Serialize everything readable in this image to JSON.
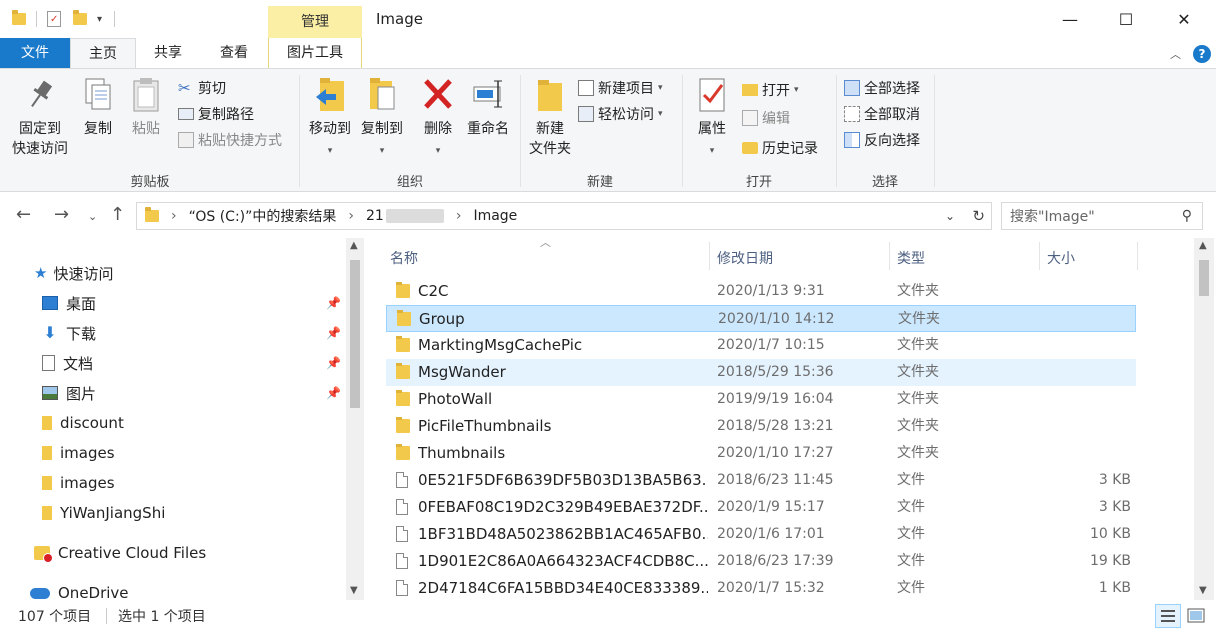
{
  "window": {
    "title": "Image",
    "context_tab": "管理",
    "minimize_glyph": "—",
    "maximize_glyph": "☐",
    "close_glyph": "✕"
  },
  "tabs": {
    "file": "文件",
    "home": "主页",
    "share": "共享",
    "view": "查看",
    "picture_tools": "图片工具",
    "help_glyph": "?"
  },
  "ribbon": {
    "clipboard": {
      "pin": "固定到",
      "pin2": "快速访问",
      "copy": "复制",
      "paste": "粘贴",
      "cut": "剪切",
      "copy_path": "复制路径",
      "paste_shortcut": "粘贴快捷方式",
      "label": "剪贴板"
    },
    "organize": {
      "move_to": "移动到",
      "copy_to": "复制到",
      "delete": "删除",
      "rename": "重命名",
      "label": "组织"
    },
    "new": {
      "new_folder": "新建",
      "new_folder2": "文件夹",
      "new_item": "新建项目",
      "easy_access": "轻松访问",
      "label": "新建"
    },
    "open": {
      "properties": "属性",
      "open": "打开",
      "edit": "编辑",
      "history": "历史记录",
      "label": "打开"
    },
    "select": {
      "select_all": "全部选择",
      "select_none": "全部取消",
      "invert": "反向选择",
      "label": "选择"
    }
  },
  "address": {
    "segment1": "“OS (C:)”中的搜索结果",
    "segment2": "21",
    "segment3": "Image",
    "search_placeholder": "搜索\"Image\""
  },
  "nav": {
    "quick_access": "快速访问",
    "items": [
      {
        "label": "桌面",
        "pinned": true
      },
      {
        "label": "下载",
        "pinned": true
      },
      {
        "label": "文档",
        "pinned": true
      },
      {
        "label": "图片",
        "pinned": true
      },
      {
        "label": "discount",
        "pinned": false
      },
      {
        "label": "images",
        "pinned": false
      },
      {
        "label": "images",
        "pinned": false
      },
      {
        "label": "YiWanJiangShi",
        "pinned": false
      }
    ],
    "creative_cloud": "Creative Cloud Files",
    "onedrive": "OneDrive"
  },
  "columns": {
    "name": "名称",
    "date": "修改日期",
    "type": "类型",
    "size": "大小"
  },
  "files": [
    {
      "name": "C2C",
      "date": "2020/1/13 9:31",
      "type": "文件夹",
      "size": "",
      "kind": "folder"
    },
    {
      "name": "Group",
      "date": "2020/1/10 14:12",
      "type": "文件夹",
      "size": "",
      "kind": "folder"
    },
    {
      "name": "MarktingMsgCachePic",
      "date": "2020/1/7 10:15",
      "type": "文件夹",
      "size": "",
      "kind": "folder"
    },
    {
      "name": "MsgWander",
      "date": "2018/5/29 15:36",
      "type": "文件夹",
      "size": "",
      "kind": "folder"
    },
    {
      "name": "PhotoWall",
      "date": "2019/9/19 16:04",
      "type": "文件夹",
      "size": "",
      "kind": "folder"
    },
    {
      "name": "PicFileThumbnails",
      "date": "2018/5/28 13:21",
      "type": "文件夹",
      "size": "",
      "kind": "folder"
    },
    {
      "name": "Thumbnails",
      "date": "2020/1/10 17:27",
      "type": "文件夹",
      "size": "",
      "kind": "folder"
    },
    {
      "name": "0E521F5DF6B639DF5B03D13BA5B63...",
      "date": "2018/6/23 11:45",
      "type": "文件",
      "size": "3 KB",
      "kind": "file"
    },
    {
      "name": "0FEBAF08C19D2C329B49EBAE372DF...",
      "date": "2020/1/9 15:17",
      "type": "文件",
      "size": "3 KB",
      "kind": "file"
    },
    {
      "name": "1BF31BD48A5023862BB1AC465AFB0...",
      "date": "2020/1/6 17:01",
      "type": "文件",
      "size": "10 KB",
      "kind": "file"
    },
    {
      "name": "1D901E2C86A0A664323ACF4CDB8C...",
      "date": "2018/6/23 17:39",
      "type": "文件",
      "size": "19 KB",
      "kind": "file"
    },
    {
      "name": "2D47184C6FA15BBD34E40CE833389...",
      "date": "2020/1/7 15:32",
      "type": "文件",
      "size": "1 KB",
      "kind": "file"
    }
  ],
  "status": {
    "count": "107 个项目",
    "selected": "选中 1 个项目"
  },
  "colors": {
    "accent": "#1979ca",
    "selected_row": "#cce8ff",
    "context_tab": "#fbeea5"
  }
}
